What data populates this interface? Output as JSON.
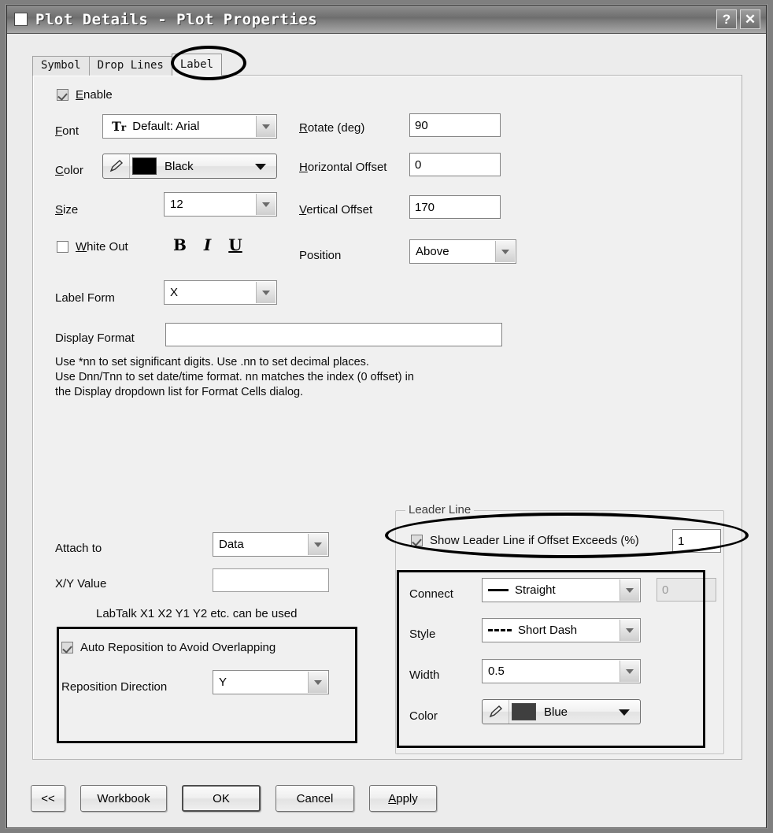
{
  "window": {
    "title": "Plot Details - Plot Properties",
    "help_button": "?",
    "close_button": "✕"
  },
  "tabs": [
    {
      "label": "Symbol",
      "active": false
    },
    {
      "label": "Drop Lines",
      "active": false
    },
    {
      "label": "Label",
      "active": true
    }
  ],
  "label_tab": {
    "enable": {
      "label": "Enable",
      "checked": true
    },
    "font": {
      "label": "Font",
      "value": "Default: Arial",
      "icon": "font-tt-icon"
    },
    "color": {
      "label": "Color",
      "value": "Black",
      "swatch_hex": "#000000"
    },
    "size": {
      "label": "Size",
      "value": "12"
    },
    "white_out": {
      "label": "White Out",
      "checked": false
    },
    "style_buttons": {
      "bold": "B",
      "italic": "I",
      "underline": "U"
    },
    "label_form": {
      "label": "Label Form",
      "value": "X"
    },
    "rotate": {
      "label": "Rotate (deg)",
      "value": "90"
    },
    "horizontal_offset": {
      "label": "Horizontal Offset",
      "value": "0"
    },
    "vertical_offset": {
      "label": "Vertical Offset",
      "value": "170"
    },
    "position": {
      "label": "Position",
      "value": "Above"
    },
    "display_format": {
      "label": "Display Format",
      "value": ""
    },
    "display_format_help": "Use *nn to set significant digits. Use .nn to set decimal places.\nUse Dnn/Tnn to set date/time format. nn matches the index (0 offset) in\nthe Display dropdown list for Format Cells dialog.",
    "attach_to": {
      "label": "Attach to",
      "value": "Data"
    },
    "xy_value": {
      "label": "X/Y Value",
      "value": ""
    },
    "labtalk_hint": "LabTalk X1 X2 Y1 Y2 etc. can be used",
    "auto_reposition": {
      "label": "Auto Reposition to Avoid Overlapping",
      "checked": true
    },
    "reposition_direction": {
      "label": "Reposition Direction",
      "value": "Y"
    },
    "leader_line": {
      "legend": "Leader Line",
      "show_if_offset": {
        "label": "Show Leader Line if Offset Exceeds (%)",
        "checked": true,
        "value": "1"
      },
      "connect": {
        "label": "Connect",
        "value": "Straight"
      },
      "connect_extra": {
        "value": "0",
        "disabled": true
      },
      "style": {
        "label": "Style",
        "value": "Short Dash"
      },
      "width": {
        "label": "Width",
        "value": "0.5"
      },
      "color": {
        "label": "Color",
        "value": "Blue",
        "swatch_hex": "#3f3f3f"
      }
    }
  },
  "buttons": {
    "collapse": "<<",
    "workbook": "Workbook",
    "ok": "OK",
    "cancel": "Cancel",
    "apply": "Apply"
  }
}
